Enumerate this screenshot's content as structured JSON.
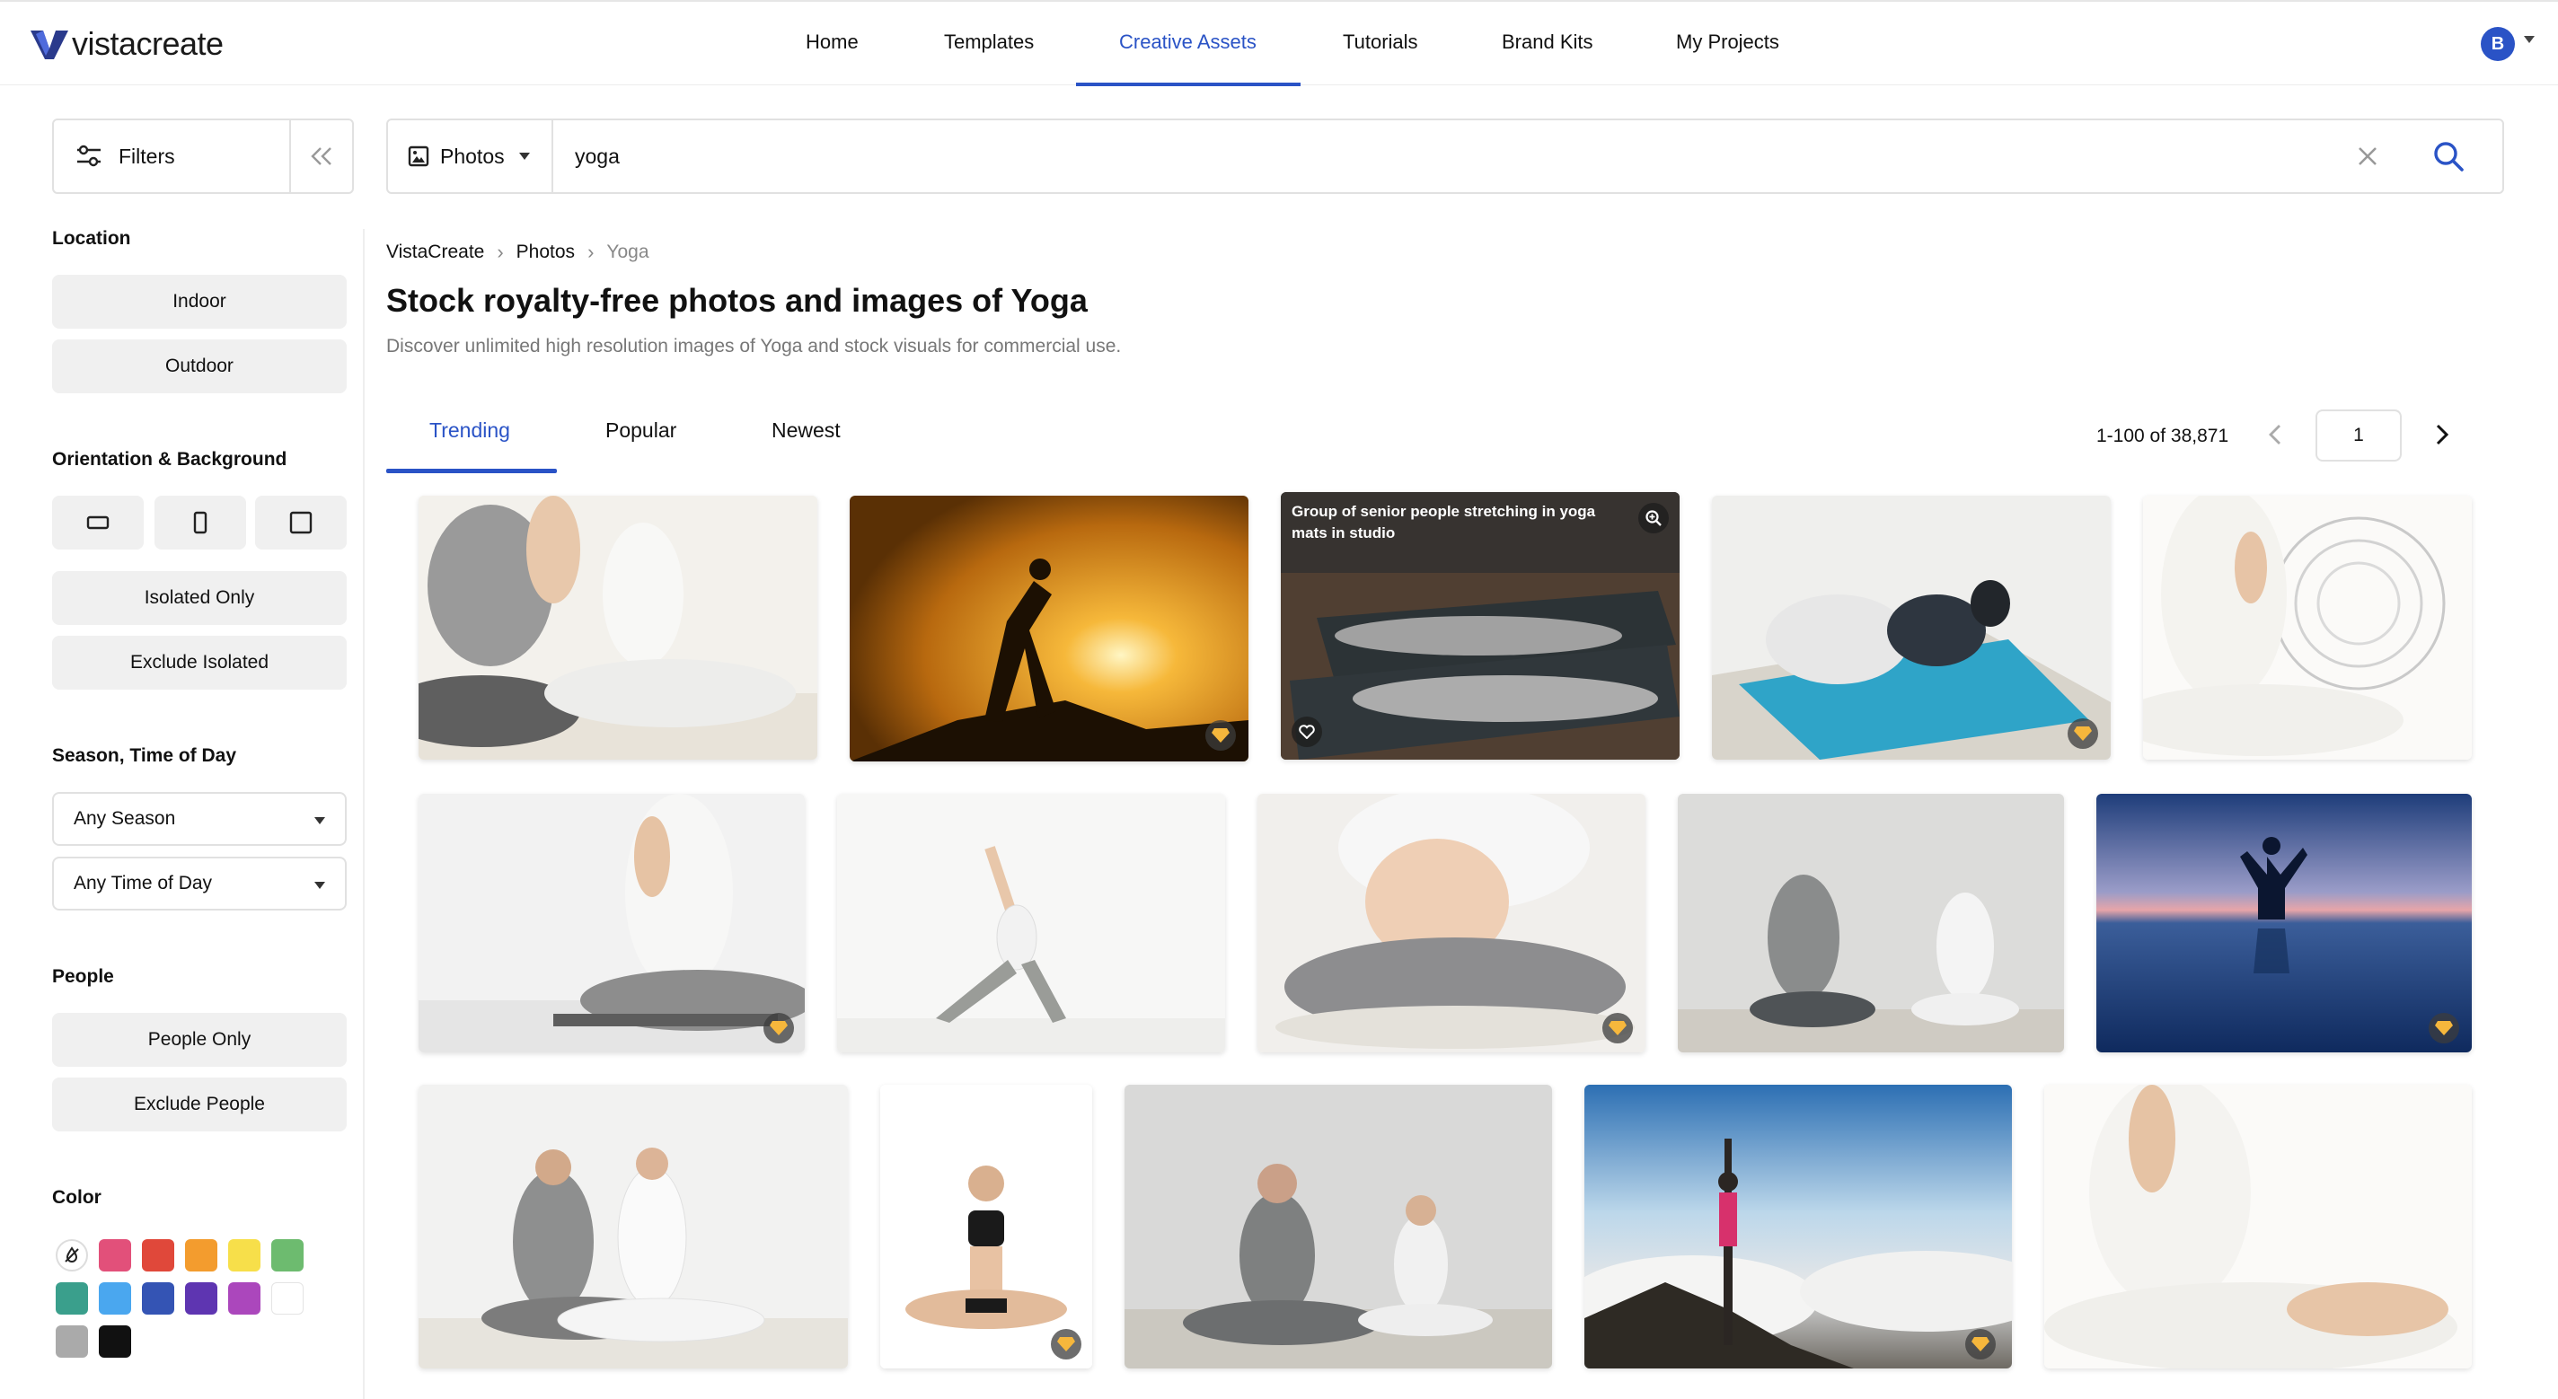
{
  "brand": {
    "logo_text": "vistacreate"
  },
  "nav": {
    "items": [
      "Home",
      "Templates",
      "Creative Assets",
      "Tutorials",
      "Brand Kits",
      "My Projects"
    ],
    "active": "Creative Assets",
    "avatar_initial": "B"
  },
  "filters": {
    "label": "Filters",
    "collapse_label": "<<"
  },
  "search": {
    "type_label": "Photos",
    "query": "yoga"
  },
  "sidebar": {
    "location": {
      "title": "Location",
      "options": [
        "Indoor",
        "Outdoor"
      ]
    },
    "orientation": {
      "title": "Orientation & Background",
      "isolated_only": "Isolated Only",
      "exclude_isolated": "Exclude Isolated"
    },
    "season": {
      "title": "Season, Time of Day",
      "season_value": "Any Season",
      "time_value": "Any Time of Day"
    },
    "people": {
      "title": "People",
      "people_only": "People Only",
      "exclude_people": "Exclude People"
    },
    "color": {
      "title": "Color",
      "swatches": [
        "#e2507a",
        "#e0483a",
        "#f39c2e",
        "#f7df4a",
        "#6dbb6f",
        "#3a9f8c",
        "#4aa7ef",
        "#3454b4",
        "#5e35b1",
        "#ab47bc",
        "#ffffff",
        "#aaaaaa",
        "#111111"
      ]
    }
  },
  "breadcrumb": {
    "items": [
      "VistaCreate",
      "Photos",
      "Yoga"
    ]
  },
  "page": {
    "title": "Stock royalty-free photos and images of Yoga",
    "subtitle": "Discover unlimited high resolution images of Yoga and stock visuals for commercial use."
  },
  "tabs": {
    "items": [
      "Trending",
      "Popular",
      "Newest"
    ],
    "active": "Trending"
  },
  "pagination": {
    "count": "1-100 of 38,871",
    "page": "1"
  },
  "photos": {
    "hover_title": "Group of senior people stretching in yoga mats in studio",
    "premium_icon": "premium-gem-icon"
  },
  "colors": {
    "accent": "#2a53c6",
    "border": "#e1e1e1",
    "pill_bg": "#f0f0f0"
  }
}
